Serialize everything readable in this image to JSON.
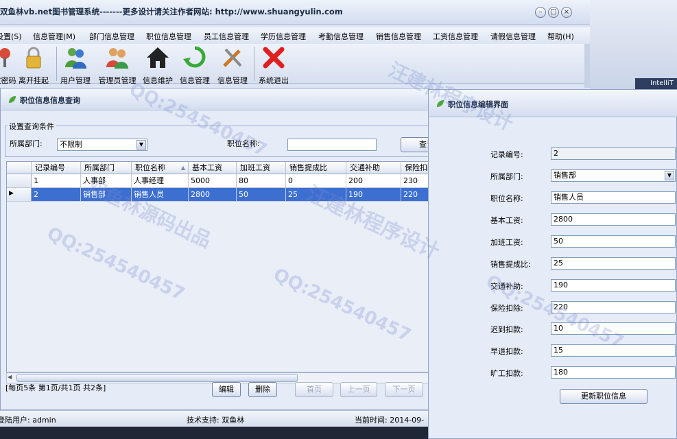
{
  "window": {
    "title": "双鱼林vb.net图书管理系统-------更多设计请关注作者网站:   http://www.shuangyulin.com",
    "buttons": {
      "minimize": "–",
      "maximize": "□",
      "close": "×"
    }
  },
  "menu": [
    "设置(S)",
    "信息管理(M)",
    "部门信息管理",
    "职位信息管理",
    "员工信息管理",
    "学历信息管理",
    "考勤信息管理",
    "销售信息管理",
    "工资信息管理",
    "请假信息管理",
    "帮助(H)"
  ],
  "toolbar": [
    {
      "label": "改密码",
      "icon": "key-icon"
    },
    {
      "label": "离开挂起",
      "icon": "lock-icon"
    },
    {
      "label": "用户管理",
      "icon": "users-icon"
    },
    {
      "label": "管理员管理",
      "icon": "admins-icon"
    },
    {
      "label": "信息维护",
      "icon": "home-icon"
    },
    {
      "label": "信息管理",
      "icon": "recycle-icon"
    },
    {
      "label": "信息管理",
      "icon": "tools-icon"
    },
    {
      "label": "系统退出",
      "icon": "exit-icon"
    }
  ],
  "query_panel": {
    "title": "职位信息信息查询",
    "group_label": "设置查询条件",
    "dept_label": "所属部门:",
    "dept_value": "不限制",
    "pos_label": "职位名称:",
    "pos_value": "",
    "search_button": "查询",
    "columns": [
      "记录编号",
      "所属部门",
      "职位名称",
      "基本工资",
      "加班工资",
      "销售提成比",
      "交通补助",
      "保险扣除"
    ],
    "rows": [
      [
        "1",
        "人事部",
        "人事经理",
        "5000",
        "80",
        "0",
        "200",
        "230"
      ],
      [
        "2",
        "销售部",
        "销售人员",
        "2800",
        "50",
        "25",
        "190",
        "220"
      ]
    ],
    "pager_info": "[每页5条 第1页/共1页    共2条]",
    "edit_button": "编辑",
    "delete_button": "删除",
    "first_button": "首页",
    "prev_button": "上一页",
    "next_button": "下一页"
  },
  "edit_panel": {
    "title": "职位信息编辑界面",
    "fields": [
      {
        "label": "记录编号:",
        "value": "2"
      },
      {
        "label": "所属部门:",
        "value": "销售部"
      },
      {
        "label": "职位名称:",
        "value": "销售人员"
      },
      {
        "label": "基本工资:",
        "value": "2800"
      },
      {
        "label": "加班工资:",
        "value": "50"
      },
      {
        "label": "销售提成比:",
        "value": "25"
      },
      {
        "label": "交通补助:",
        "value": "190"
      },
      {
        "label": "保险扣除:",
        "value": "220"
      },
      {
        "label": "迟到扣款:",
        "value": "10"
      },
      {
        "label": "早退扣款:",
        "value": "15"
      },
      {
        "label": "旷工扣款:",
        "value": "180"
      }
    ],
    "update_button": "更新职位信息"
  },
  "status": {
    "user": "登陆用户:   admin",
    "support": "技术支持:  双鱼林",
    "time": "当前时间:    2014-09-"
  },
  "taskbar": {
    "intelli": "IntelliT"
  },
  "watermarks": [
    "QQ:254540457",
    "汪建林程序设计",
    "双鱼林源码出品"
  ],
  "colors": {
    "selection": "#3d6fd1",
    "window_bg": "#e6ecf7",
    "exit_red": "#e02020"
  }
}
